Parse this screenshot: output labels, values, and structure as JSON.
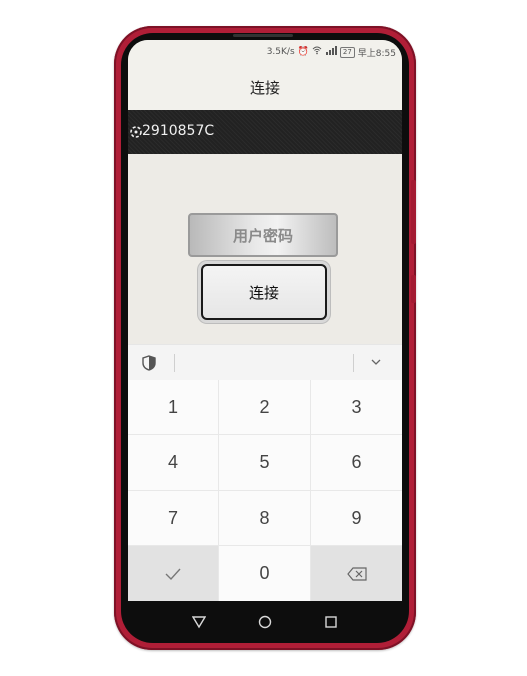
{
  "status_bar": {
    "speed": "3.5K/s",
    "battery": "27",
    "time": "早上8:55"
  },
  "title": "连接",
  "device": {
    "id": "2910857C",
    "icon": "bluetooth-device-icon"
  },
  "buttons": {
    "password_label": "用户密码",
    "connect_label": "连接"
  },
  "keyboard": {
    "keys": [
      "1",
      "2",
      "3",
      "4",
      "5",
      "6",
      "7",
      "8",
      "9",
      "0"
    ],
    "icons": {
      "security": "shield-icon",
      "collapse": "chevron-down-icon",
      "confirm": "check-icon",
      "delete": "backspace-icon"
    }
  },
  "nav": {
    "back": "back-triangle-icon",
    "home": "home-circle-icon",
    "recents": "recents-square-icon"
  },
  "colors": {
    "frame": "#b01e37",
    "device_row": "#222222",
    "background": "#edebe6"
  }
}
